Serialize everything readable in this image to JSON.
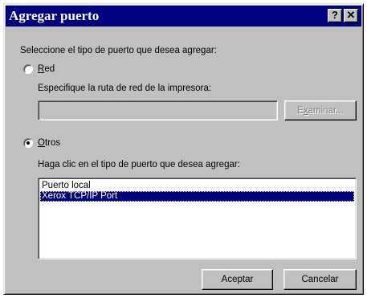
{
  "window": {
    "title": "Agregar puerto",
    "help_glyph": "?",
    "close_glyph": "✕"
  },
  "prompt": "Seleccione el tipo de puerto que desea agregar:",
  "red": {
    "label_accel": "R",
    "label_rest": "ed",
    "selected": false,
    "path_label": "Especifique la ruta de red de la impresora:",
    "path_value": "",
    "browse_accel": "x",
    "browse_pre": "E",
    "browse_post": "aminar..."
  },
  "otros": {
    "label_accel": "O",
    "label_rest": "tros",
    "selected": true,
    "list_label": "Haga clic en el tipo de puerto que desea agregar:",
    "port_types": [
      "Puerto local",
      "Xerox TCP/IP Port"
    ],
    "selected_port": "Xerox TCP/IP Port"
  },
  "buttons": {
    "ok": "Aceptar",
    "cancel": "Cancelar"
  }
}
